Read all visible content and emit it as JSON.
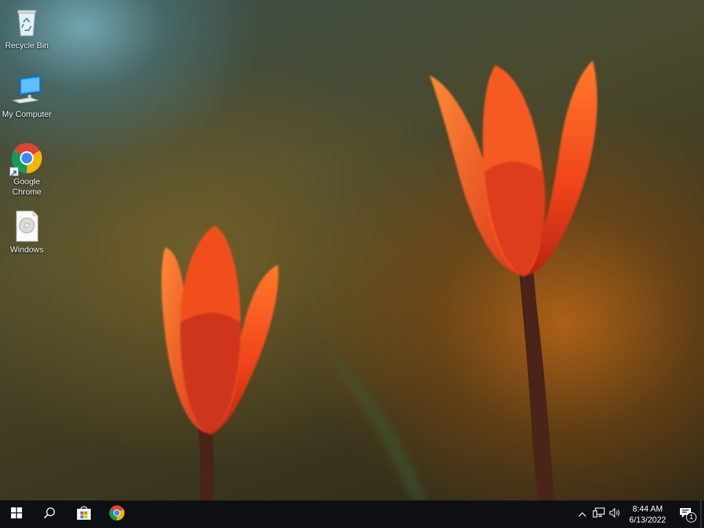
{
  "desktop": {
    "icons": [
      {
        "label": "Recycle Bin",
        "icon": "recycle-bin-icon"
      },
      {
        "label": "My Computer",
        "icon": "computer-icon"
      },
      {
        "label": "Google Chrome",
        "icon": "chrome-icon",
        "shortcut": true
      },
      {
        "label": "Windows",
        "icon": "disc-image-file-icon"
      }
    ]
  },
  "taskbar": {
    "start": {
      "icon": "windows-logo-icon"
    },
    "search": {
      "icon": "search-icon"
    },
    "pinned": [
      {
        "app": "Microsoft Store",
        "icon": "store-icon"
      },
      {
        "app": "Google Chrome",
        "icon": "chrome-icon"
      }
    ],
    "tray": {
      "icons": [
        "chevron-up-icon",
        "network-icon",
        "volume-icon"
      ],
      "time": "8:44 AM",
      "date": "6/13/2022",
      "notifications_count": "1"
    }
  },
  "colors": {
    "taskbar_bg": "#0d0f12",
    "text": "#ffffff",
    "tulip_orange": "#ff5a1e"
  }
}
